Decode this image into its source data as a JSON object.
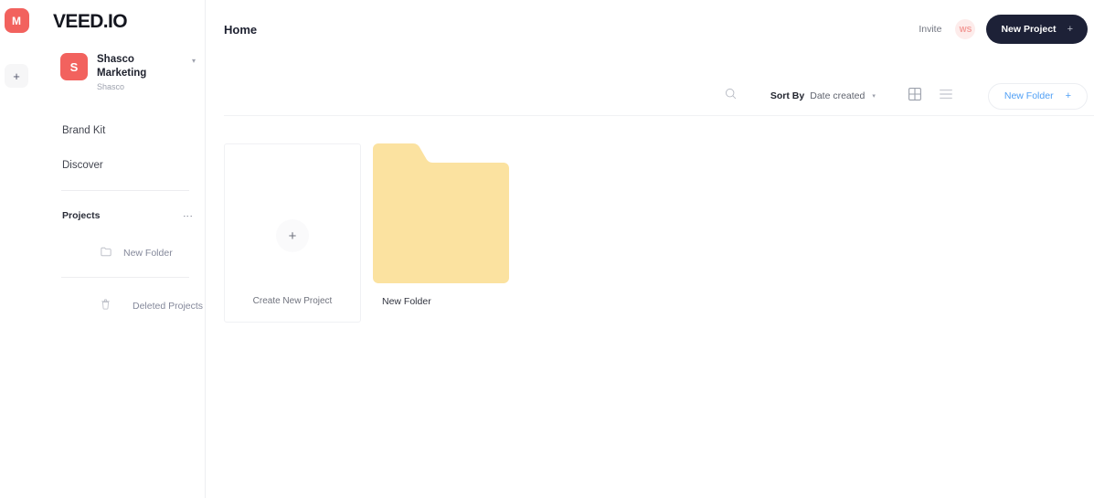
{
  "icon_rail": {
    "avatar_initial": "M",
    "avatar_color": "#f2625e",
    "add_label": "+"
  },
  "sidebar": {
    "brand": "VEED.IO",
    "workspace": {
      "avatar_initial": "S",
      "avatar_color": "#f2625e",
      "name": "Shasco Marketing",
      "subtitle": "Shasco",
      "caret": "▾"
    },
    "links": [
      {
        "label": "Brand Kit"
      },
      {
        "label": "Discover"
      }
    ],
    "projects_section": {
      "label": "Projects",
      "menu_glyph": "⋮",
      "items": [
        {
          "label": "New Folder",
          "icon": "folder-icon"
        }
      ]
    },
    "deleted": {
      "label": "Deleted Projects",
      "icon": "trash-icon"
    }
  },
  "header": {
    "title": "Home",
    "invite_label": "Invite",
    "workspace_badge": "WS",
    "workspace_badge_bg": "#fdeceb",
    "workspace_badge_color": "#f39a97",
    "new_project_label": "New Project",
    "new_project_plus": "+",
    "new_project_bg": "#1d2137"
  },
  "toolbar": {
    "search_icon": "search-icon",
    "sort_by_label": "Sort By",
    "sort_by_value": "Date created",
    "sort_caret": "▾",
    "view_grid_icon": "grid-view-icon",
    "view_list_icon": "list-view-icon",
    "new_folder_label": "New Folder",
    "new_folder_plus": "+",
    "new_folder_color": "#4f9ff5"
  },
  "content": {
    "create_card": {
      "plus": "+",
      "label": "Create New Project"
    },
    "folders": [
      {
        "name": "New Folder",
        "color": "#fbe2a0"
      }
    ]
  }
}
